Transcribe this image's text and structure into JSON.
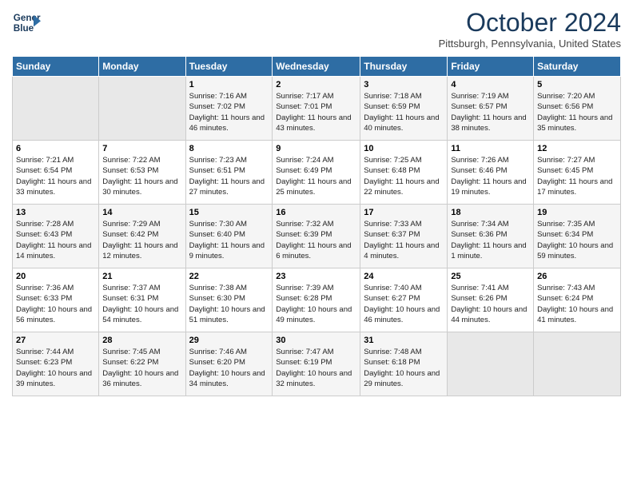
{
  "header": {
    "logo_line1": "General",
    "logo_line2": "Blue",
    "month": "October 2024",
    "location": "Pittsburgh, Pennsylvania, United States"
  },
  "days_of_week": [
    "Sunday",
    "Monday",
    "Tuesday",
    "Wednesday",
    "Thursday",
    "Friday",
    "Saturday"
  ],
  "weeks": [
    [
      {
        "day": "",
        "info": ""
      },
      {
        "day": "",
        "info": ""
      },
      {
        "day": "1",
        "info": "Sunrise: 7:16 AM\nSunset: 7:02 PM\nDaylight: 11 hours and 46 minutes."
      },
      {
        "day": "2",
        "info": "Sunrise: 7:17 AM\nSunset: 7:01 PM\nDaylight: 11 hours and 43 minutes."
      },
      {
        "day": "3",
        "info": "Sunrise: 7:18 AM\nSunset: 6:59 PM\nDaylight: 11 hours and 40 minutes."
      },
      {
        "day": "4",
        "info": "Sunrise: 7:19 AM\nSunset: 6:57 PM\nDaylight: 11 hours and 38 minutes."
      },
      {
        "day": "5",
        "info": "Sunrise: 7:20 AM\nSunset: 6:56 PM\nDaylight: 11 hours and 35 minutes."
      }
    ],
    [
      {
        "day": "6",
        "info": "Sunrise: 7:21 AM\nSunset: 6:54 PM\nDaylight: 11 hours and 33 minutes."
      },
      {
        "day": "7",
        "info": "Sunrise: 7:22 AM\nSunset: 6:53 PM\nDaylight: 11 hours and 30 minutes."
      },
      {
        "day": "8",
        "info": "Sunrise: 7:23 AM\nSunset: 6:51 PM\nDaylight: 11 hours and 27 minutes."
      },
      {
        "day": "9",
        "info": "Sunrise: 7:24 AM\nSunset: 6:49 PM\nDaylight: 11 hours and 25 minutes."
      },
      {
        "day": "10",
        "info": "Sunrise: 7:25 AM\nSunset: 6:48 PM\nDaylight: 11 hours and 22 minutes."
      },
      {
        "day": "11",
        "info": "Sunrise: 7:26 AM\nSunset: 6:46 PM\nDaylight: 11 hours and 19 minutes."
      },
      {
        "day": "12",
        "info": "Sunrise: 7:27 AM\nSunset: 6:45 PM\nDaylight: 11 hours and 17 minutes."
      }
    ],
    [
      {
        "day": "13",
        "info": "Sunrise: 7:28 AM\nSunset: 6:43 PM\nDaylight: 11 hours and 14 minutes."
      },
      {
        "day": "14",
        "info": "Sunrise: 7:29 AM\nSunset: 6:42 PM\nDaylight: 11 hours and 12 minutes."
      },
      {
        "day": "15",
        "info": "Sunrise: 7:30 AM\nSunset: 6:40 PM\nDaylight: 11 hours and 9 minutes."
      },
      {
        "day": "16",
        "info": "Sunrise: 7:32 AM\nSunset: 6:39 PM\nDaylight: 11 hours and 6 minutes."
      },
      {
        "day": "17",
        "info": "Sunrise: 7:33 AM\nSunset: 6:37 PM\nDaylight: 11 hours and 4 minutes."
      },
      {
        "day": "18",
        "info": "Sunrise: 7:34 AM\nSunset: 6:36 PM\nDaylight: 11 hours and 1 minute."
      },
      {
        "day": "19",
        "info": "Sunrise: 7:35 AM\nSunset: 6:34 PM\nDaylight: 10 hours and 59 minutes."
      }
    ],
    [
      {
        "day": "20",
        "info": "Sunrise: 7:36 AM\nSunset: 6:33 PM\nDaylight: 10 hours and 56 minutes."
      },
      {
        "day": "21",
        "info": "Sunrise: 7:37 AM\nSunset: 6:31 PM\nDaylight: 10 hours and 54 minutes."
      },
      {
        "day": "22",
        "info": "Sunrise: 7:38 AM\nSunset: 6:30 PM\nDaylight: 10 hours and 51 minutes."
      },
      {
        "day": "23",
        "info": "Sunrise: 7:39 AM\nSunset: 6:28 PM\nDaylight: 10 hours and 49 minutes."
      },
      {
        "day": "24",
        "info": "Sunrise: 7:40 AM\nSunset: 6:27 PM\nDaylight: 10 hours and 46 minutes."
      },
      {
        "day": "25",
        "info": "Sunrise: 7:41 AM\nSunset: 6:26 PM\nDaylight: 10 hours and 44 minutes."
      },
      {
        "day": "26",
        "info": "Sunrise: 7:43 AM\nSunset: 6:24 PM\nDaylight: 10 hours and 41 minutes."
      }
    ],
    [
      {
        "day": "27",
        "info": "Sunrise: 7:44 AM\nSunset: 6:23 PM\nDaylight: 10 hours and 39 minutes."
      },
      {
        "day": "28",
        "info": "Sunrise: 7:45 AM\nSunset: 6:22 PM\nDaylight: 10 hours and 36 minutes."
      },
      {
        "day": "29",
        "info": "Sunrise: 7:46 AM\nSunset: 6:20 PM\nDaylight: 10 hours and 34 minutes."
      },
      {
        "day": "30",
        "info": "Sunrise: 7:47 AM\nSunset: 6:19 PM\nDaylight: 10 hours and 32 minutes."
      },
      {
        "day": "31",
        "info": "Sunrise: 7:48 AM\nSunset: 6:18 PM\nDaylight: 10 hours and 29 minutes."
      },
      {
        "day": "",
        "info": ""
      },
      {
        "day": "",
        "info": ""
      }
    ]
  ]
}
